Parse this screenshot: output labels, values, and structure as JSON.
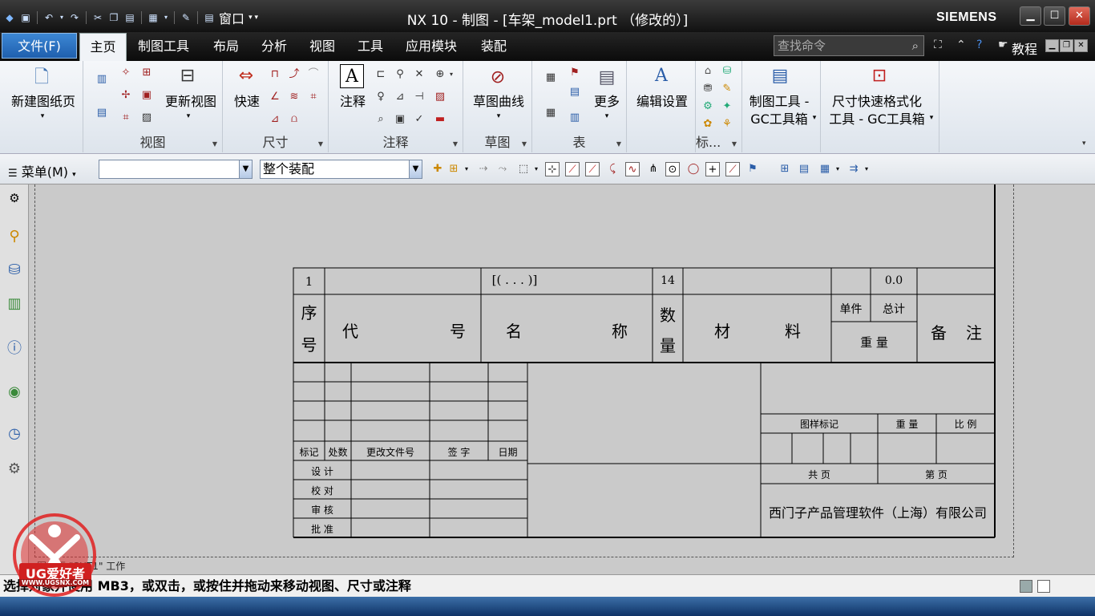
{
  "window": {
    "title": "NX 10 - 制图 - [车架_model1.prt （修改的）]",
    "brand": "SIEMENS",
    "window_menu": "窗口"
  },
  "menubar": {
    "file": "文件(F)",
    "tabs": [
      "主页",
      "制图工具",
      "布局",
      "分析",
      "视图",
      "工具",
      "应用模块",
      "装配"
    ],
    "search_placeholder": "查找命令",
    "tutorial": "教程"
  },
  "ribbon": {
    "new_sheet": "新建图纸页",
    "update_view": "更新视图",
    "quick": "快速",
    "note": "注释",
    "sketch_curve": "草图曲线",
    "more": "更多",
    "edit_settings": "编辑设置",
    "gc1_line1": "制图工具 -",
    "gc1_line2": "GC工具箱",
    "gc2_line1": "尺寸快速格式化",
    "gc2_line2": "工具 - GC工具箱",
    "groups": [
      "视图",
      "尺寸",
      "注释",
      "草图",
      "表",
      "标..."
    ]
  },
  "toolbar2": {
    "menu": "菜单(M)",
    "filter": "",
    "scope": "整个装配"
  },
  "drawing": {
    "row1": {
      "item": "1",
      "name": "[( . . . )]",
      "qty": "14",
      "weight": "0.0"
    },
    "header": {
      "seq1": "序",
      "seq2": "号",
      "code1": "代",
      "code2": "号",
      "name1": "名",
      "name2": "称",
      "qty1": "数",
      "qty2": "量",
      "mat1": "材",
      "mat2": "料",
      "unit": "单件",
      "total": "总计",
      "weight": "重  量",
      "remark1": "备",
      "remark2": "注"
    },
    "rev": {
      "mark": "标记",
      "count": "处数",
      "doc": "更改文件号",
      "sign": "签  字",
      "date": "日期",
      "design": "设  计",
      "check": "校  对",
      "review": "审  核",
      "approve": "批  准"
    },
    "title": {
      "drawing_mark": "图样标记",
      "weight": "重  量",
      "scale": "比  例",
      "total_pages": "共    页",
      "page": "第    页",
      "company": "西门子产品管理软件（上海）有限公司"
    }
  },
  "canvas": {
    "sheet_label": "图纸页 \"SHT1\" 工作"
  },
  "status": {
    "text": "选择对象并使用 MB3，或双击，或按住并拖动来移动视图、尺寸或注释"
  },
  "logo": {
    "text": "UG爱好者",
    "url": "WWW.UGSNX.COM"
  }
}
